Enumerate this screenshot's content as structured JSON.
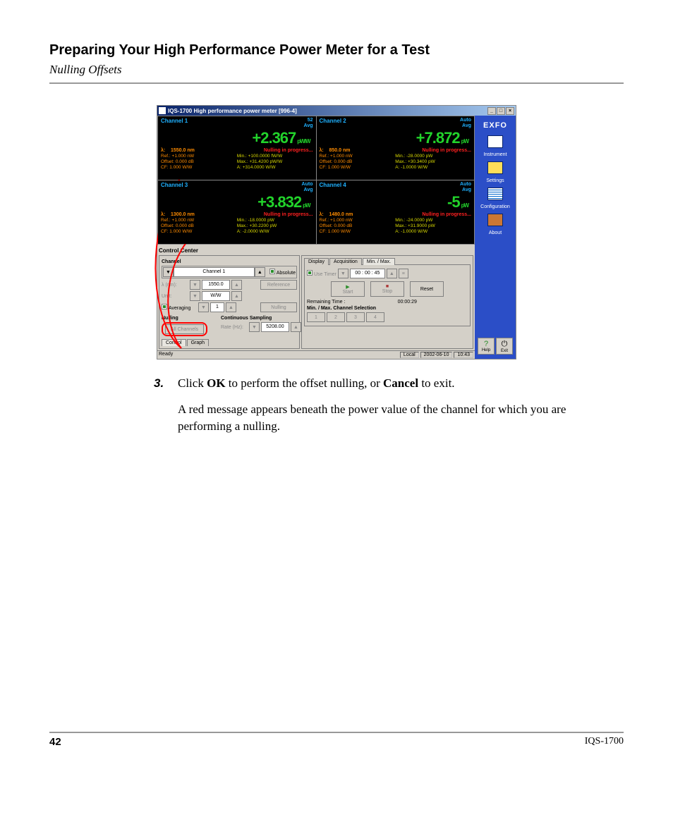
{
  "doc": {
    "heading": "Preparing Your High Performance Power Meter for a Test",
    "subheading": "Nulling Offsets",
    "step_num": "3.",
    "step_text_pre": "Click ",
    "step_bold1": "OK",
    "step_text_mid": " to perform the offset nulling, or ",
    "step_bold2": "Cancel",
    "step_text_post": " to exit.",
    "para2": "A red message appears beneath the power value of the channel for which you are performing a nulling.",
    "page_number": "42",
    "model": "IQS-1700"
  },
  "win": {
    "title": "IQS-1700 High performance power meter [996-4]",
    "status_ready": "Ready",
    "status_local": "Local",
    "status_date": "2002-06-10",
    "status_time": "10:43"
  },
  "sidebar": {
    "logo": "EXFO",
    "items": [
      "Instrument",
      "Settings",
      "Configuration",
      "About"
    ],
    "help": "Help",
    "exit": "Exit"
  },
  "channels": [
    {
      "name": "Channel 1",
      "mode1": "52",
      "mode2": "Avg",
      "value": "+2.367",
      "unit": "pW/W",
      "lambda": "1550.0 nm",
      "prog": "Nulling in progress...",
      "col1": [
        "Ref.:",
        "Offset:",
        "CF:"
      ],
      "col1v": [
        "+1.000 nW",
        "0.000 dB",
        "1.000 W/W"
      ],
      "col2": [
        "Min.:",
        "Max.:",
        "A:"
      ],
      "col2v": [
        "+100.0000 fW/W",
        "+31.4200 pW/W",
        "+314.0000 W/W"
      ]
    },
    {
      "name": "Channel 2",
      "mode1": "Auto",
      "mode2": "Avg",
      "value": "+7.872",
      "unit": "pW",
      "lambda": "850.0 nm",
      "prog": "Nulling in progress...",
      "col1": [
        "Ref.:",
        "Offset:",
        "CF:"
      ],
      "col1v": [
        "+1.000 nW",
        "0.000 dB",
        "1.000 W/W"
      ],
      "col2": [
        "Min.:",
        "Max.:",
        "A:"
      ],
      "col2v": [
        "-28.0000 pW",
        "+30.3400 pW",
        "-1.0000 W/W"
      ]
    },
    {
      "name": "Channel 3",
      "mode1": "Auto",
      "mode2": "Avg",
      "value": "+3.832",
      "unit": "pW",
      "lambda": "1300.0 nm",
      "prog": "Nulling in progress...",
      "col1": [
        "Ref.:",
        "Offset:",
        "CF:"
      ],
      "col1v": [
        "+1.000 nW",
        "0.000 dB",
        "1.000 W/W"
      ],
      "col2": [
        "Min.:",
        "Max.:",
        "A:"
      ],
      "col2v": [
        "-18.0000 pW",
        "+30.2200 pW",
        "-2.0000 W/W"
      ]
    },
    {
      "name": "Channel 4",
      "mode1": "Auto",
      "mode2": "Avg",
      "value": "-5",
      "unit": "pW",
      "lambda": "1480.0 nm",
      "prog": "Nulling in progress...",
      "col1": [
        "Ref.:",
        "Offset:",
        "CF:"
      ],
      "col1v": [
        "+1.000 nW",
        "0.000 dB",
        "1.000 W/W"
      ],
      "col2": [
        "Min.:",
        "Max.:",
        "A:"
      ],
      "col2v": [
        "-24.0000 pW",
        "+31.9000 pW",
        "-1.0000 W/W"
      ]
    }
  ],
  "controlCenter": {
    "title": "Control Center",
    "channel_group": "Channel",
    "channel_val": "Channel 1",
    "absolute": "Absolute",
    "lambda_lbl": "λ (nm):",
    "lambda_val": "1550.0",
    "unit_lbl": "Unit:",
    "unit_val": "W/W",
    "reference": "Reference",
    "averaging": "Averaging",
    "avg_val": "1",
    "nulling_btn": "Nulling",
    "nulling_group": "Nulling",
    "all_channels": "All Channels",
    "cont_sampling": "Continuous Sampling",
    "rate_lbl": "Rate (Hz):",
    "rate_val": "5208.00",
    "tab_control": "Control",
    "tab_graph": "Graph"
  },
  "rightPanel": {
    "tabs": [
      "Display",
      "Acquisition",
      "Min. / Max."
    ],
    "use_timer": "Use Timer",
    "timer_val": "00 : 00 : 45",
    "start": "Start",
    "stop": "Stop",
    "reset": "Reset",
    "remaining_lbl": "Remaining Time :",
    "remaining_val": "00:00:29",
    "minmax_sel": "Min. / Max. Channel Selection",
    "ch_btns": [
      "1",
      "2",
      "3",
      "4"
    ]
  }
}
